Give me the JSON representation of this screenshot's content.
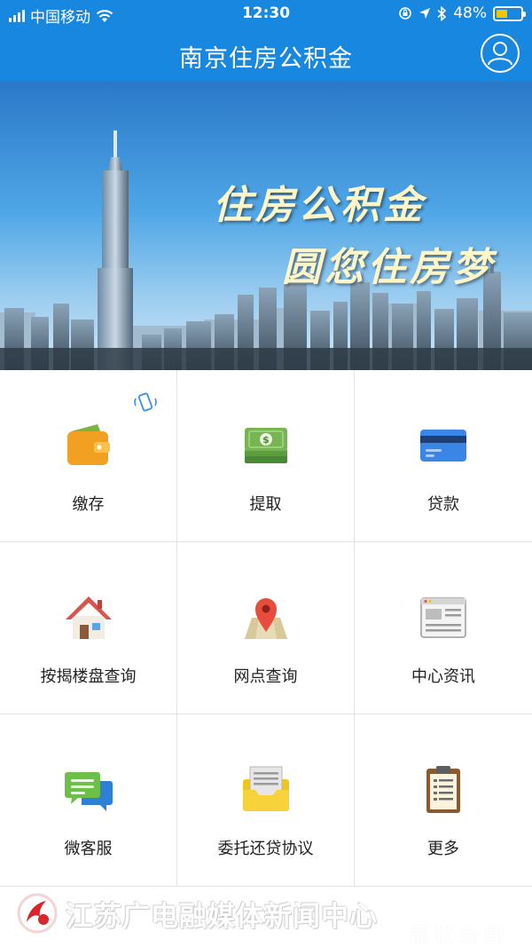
{
  "status_bar": {
    "carrier": "中国移动",
    "time": "12:30",
    "battery_text": "48%",
    "battery_level": 0.48,
    "icons": [
      "signal-icon",
      "wifi-icon",
      "orientation-lock-icon",
      "location-icon",
      "bluetooth-icon",
      "battery-icon"
    ]
  },
  "nav": {
    "title": "南京住房公积金",
    "profile_icon": "user-profile-icon"
  },
  "banner": {
    "slogan_line1": "住房公积金",
    "slogan_line2": "圆您住房梦"
  },
  "grid": [
    {
      "label": "缴存",
      "icon": "wallet-icon"
    },
    {
      "label": "提取",
      "icon": "cash-stack-icon"
    },
    {
      "label": "贷款",
      "icon": "credit-card-icon"
    },
    {
      "label": "按揭楼盘查询",
      "icon": "house-icon"
    },
    {
      "label": "网点查询",
      "icon": "map-pin-icon"
    },
    {
      "label": "中心资讯",
      "icon": "news-window-icon"
    },
    {
      "label": "微客服",
      "icon": "chat-bubbles-icon"
    },
    {
      "label": "委托还贷协议",
      "icon": "document-folder-icon"
    },
    {
      "label": "更多",
      "icon": "clipboard-list-icon"
    }
  ],
  "colors": {
    "header_blue": "#1787e0",
    "battery_yellow": "#f5c400",
    "grid_border": "#e3e3e3"
  },
  "watermark": {
    "text": "江苏广电融媒体新闻中心",
    "faint_text": "荔枝新闻"
  }
}
